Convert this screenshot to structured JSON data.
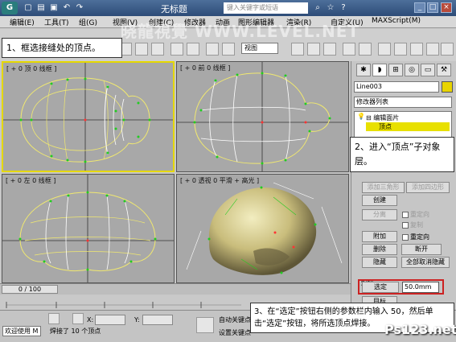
{
  "window": {
    "title": "无标题",
    "logo": "G",
    "search_placeholder": "键入关键字或短语"
  },
  "menu": {
    "items": [
      "编辑(E)",
      "工具(T)",
      "组(G)",
      "视图(V)",
      "创建(C)",
      "修改器",
      "动画",
      "图形编辑器",
      "渲染(R)",
      "自定义(U)",
      "MAXScript(M)"
    ]
  },
  "watermark_text": "晓龍視覺 WWW.LEVEL.NET",
  "toolbar": {
    "view_select": "视图"
  },
  "viewports": {
    "top": {
      "label": "[ + 0 顶 0 线框 ]"
    },
    "front": {
      "label": "[ + 0 前 0 线框 ]"
    },
    "left": {
      "label": "[ + 0 左 0 线框 ]"
    },
    "perspective": {
      "label": "[ + 0 透视 0 平滑 + 高光 ]"
    }
  },
  "command_panel": {
    "object_name": "Line003",
    "modifier_list": "修改器列表",
    "stack": {
      "item1": "⊟ 编辑面片",
      "item2": "顶点"
    },
    "buttons": {
      "add_triangle": "添加三角形",
      "add_quad": "添加四边形",
      "create": "创建",
      "detach": "分离",
      "attach": "附加",
      "delete": "删除",
      "break": "断开",
      "hide": "隐藏",
      "unhide_all": "全部取消隐藏",
      "weld_group": "焊接",
      "weld": "选定",
      "target": "目标"
    },
    "checkboxes": {
      "reorient": "重定向",
      "copy": "复制",
      "reorient2": "重定向"
    },
    "weld_value": "50.0mm"
  },
  "timeline": {
    "slider": "0 / 100"
  },
  "status": {
    "maxscript": "欢迎使用 M",
    "message": "焊接了 10 个顶点",
    "x_label": "X:",
    "y_label": "Y:",
    "auto_key": "自动关键点",
    "set_key": "设置关键点"
  },
  "callouts": {
    "step1": "1、框选接缝处的顶点。",
    "step2": "2、进入“顶点”子对象层。",
    "step3": "3、在“选定”按钮右侧的参数栏内输入 50，然后单击“选定”按钮，将所选顶点焊接。"
  },
  "site_watermark": "Ps123.net",
  "colors": {
    "active_border": "#e5d800",
    "stack_highlight": "#e8e000",
    "weld_highlight": "#cc2222",
    "vertex": "#22cc22",
    "mesh_line": "#f0e870"
  }
}
